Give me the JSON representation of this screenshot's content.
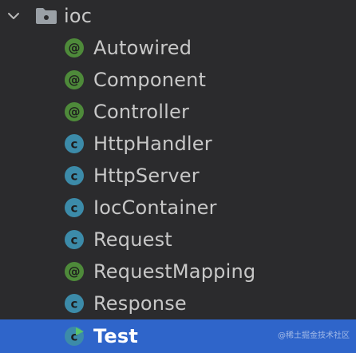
{
  "folder": {
    "name": "ioc",
    "expanded": true,
    "icons": {
      "chevron": "chevron-down-icon",
      "folder": "package-folder-icon"
    }
  },
  "colors": {
    "background": "#2b2b2d",
    "selection": "#2f65ca",
    "text": "#c8c8c8",
    "annotation_icon": "#4e8a3a",
    "class_icon": "#3c8ba9"
  },
  "items": [
    {
      "label": "Autowired",
      "kind": "annotation",
      "icon": "annotation-icon"
    },
    {
      "label": "Component",
      "kind": "annotation",
      "icon": "annotation-icon"
    },
    {
      "label": "Controller",
      "kind": "annotation",
      "icon": "annotation-icon"
    },
    {
      "label": "HttpHandler",
      "kind": "class",
      "icon": "class-icon"
    },
    {
      "label": "HttpServer",
      "kind": "class",
      "icon": "class-icon"
    },
    {
      "label": "IocContainer",
      "kind": "class",
      "icon": "class-icon"
    },
    {
      "label": "Request",
      "kind": "class",
      "icon": "class-icon"
    },
    {
      "label": "RequestMapping",
      "kind": "annotation",
      "icon": "annotation-icon"
    },
    {
      "label": "Response",
      "kind": "class",
      "icon": "class-icon"
    },
    {
      "label": "Test",
      "kind": "runnable-class",
      "icon": "runnable-class-icon",
      "selected": true
    }
  ],
  "watermark": "@稀土掘金技术社区"
}
